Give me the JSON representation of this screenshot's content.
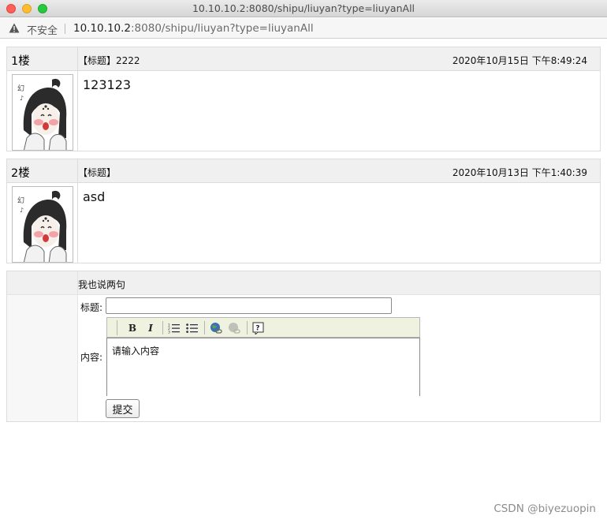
{
  "window": {
    "title": "10.10.10.2:8080/shipu/liuyan?type=liuyanAll"
  },
  "address_bar": {
    "security_label": "不安全",
    "url_host": "10.10.10.2",
    "url_rest": ":8080/shipu/liuyan?type=liuyanAll"
  },
  "posts": [
    {
      "floor": "1楼",
      "title_label": "【标题】2222",
      "date": "2020年10月15日 下午8:49:24",
      "content": "123123"
    },
    {
      "floor": "2楼",
      "title_label": "【标题】",
      "date": "2020年10月13日 下午1:40:39",
      "content": "asd"
    }
  ],
  "reply_form": {
    "heading": "我也说两句",
    "title_label": "标题:",
    "title_value": "",
    "content_label": "内容:",
    "content_placeholder": "请输入内容",
    "submit_label": "提交",
    "toolbar_icons": [
      "bold-icon",
      "italic-icon",
      "ordered-list-icon",
      "unordered-list-icon",
      "insert-link-icon",
      "remove-link-icon",
      "help-icon"
    ],
    "toolbar_bold_glyph": "B",
    "toolbar_italic_glyph": "I"
  },
  "watermark": "CSDN @biyezuopin",
  "colors": {
    "header_bg": "#f0f0f0",
    "toolbar_bg": "#eef2df",
    "close": "#fe5f57",
    "minimize": "#febc2e",
    "maximize": "#28c840"
  }
}
